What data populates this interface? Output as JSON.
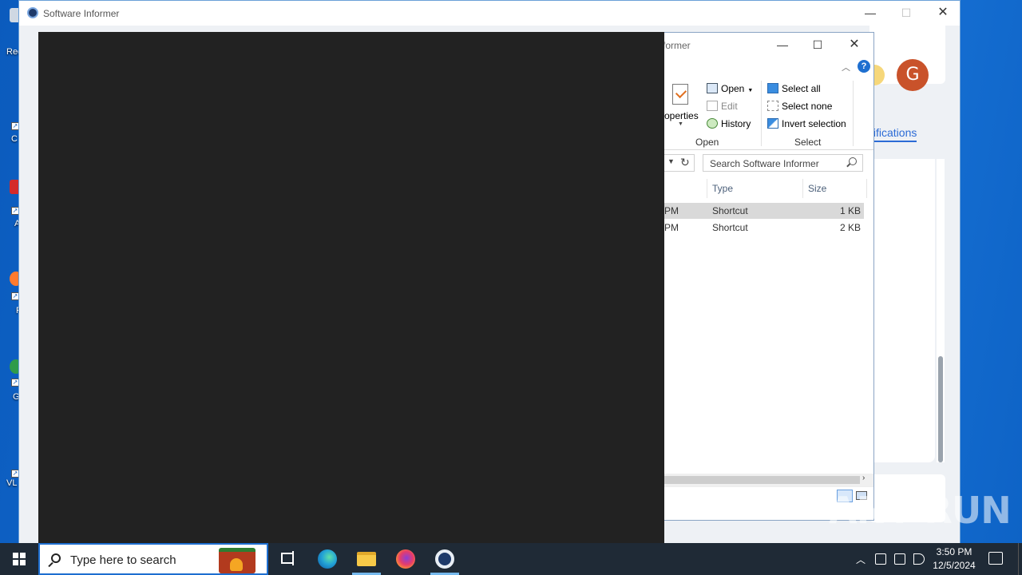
{
  "desktop": {
    "icons": [
      {
        "label": "Rec",
        "color": "#cfd8e3"
      },
      {
        "label": "C",
        "color": "#3a78c2"
      },
      {
        "label": "A",
        "color": "#d42a2a"
      },
      {
        "label": "F",
        "color": "#ff7b2e"
      },
      {
        "label": "G",
        "color": "#2f9b4a"
      },
      {
        "label": "VL",
        "color": "#f08a1e"
      }
    ]
  },
  "si_window": {
    "title": "Software Informer",
    "avatar_letter": "G",
    "notifications_label": "tifications"
  },
  "explorer": {
    "title_partial": "former",
    "help_label": "?",
    "ribbon": {
      "properties_label": "roperties",
      "open_label": "Open",
      "edit_label": "Edit",
      "history_label": "History",
      "open_group_label": "Open",
      "select_all_label": "Select all",
      "select_none_label": "Select none",
      "invert_selection_label": "Invert selection",
      "select_group_label": "Select"
    },
    "search_placeholder": "Search Software Informer",
    "columns": {
      "type": "Type",
      "size": "Size"
    },
    "rows": [
      {
        "date_suffix": "PM",
        "type": "Shortcut",
        "size": "1 KB",
        "selected": true
      },
      {
        "date_suffix": "PM",
        "type": "Shortcut",
        "size": "2 KB",
        "selected": false
      }
    ]
  },
  "watermark": "ANY RUN",
  "taskbar": {
    "search_placeholder": "Type here to search",
    "clock_time": "3:50 PM",
    "clock_date": "12/5/2024",
    "apps": [
      "task-view",
      "edge",
      "file-explorer",
      "firefox",
      "software-informer"
    ]
  },
  "colors": {
    "accent": "#1e6fd0",
    "avatar": "#c9522a",
    "overlay": "#222222"
  }
}
